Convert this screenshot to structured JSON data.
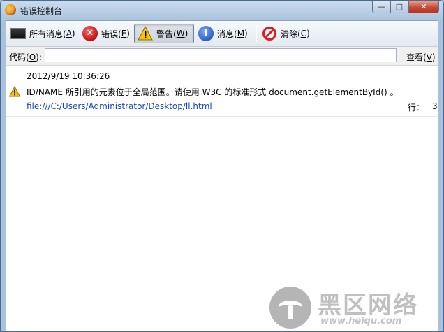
{
  "window": {
    "title": "错误控制台"
  },
  "titlebar": {
    "min_glyph": "—",
    "max_glyph": "□",
    "close_glyph": "✕"
  },
  "toolbar": {
    "all": {
      "label": "所有消息(",
      "key": "A",
      "suffix": ")"
    },
    "errors": {
      "label": "错误(",
      "key": "E",
      "suffix": ")"
    },
    "warnings": {
      "label": "警告(",
      "key": "W",
      "suffix": ")",
      "active": true
    },
    "messages": {
      "label": "消息(",
      "key": "M",
      "suffix": ")"
    },
    "clear": {
      "label": "清除(",
      "key": "C",
      "suffix": ")"
    }
  },
  "codebar": {
    "label": "代码(",
    "key": "O",
    "suffix": "):",
    "value": "",
    "view_label": "查看(",
    "view_key": "V",
    "view_suffix": ")"
  },
  "entries": [
    {
      "type": "warning",
      "timestamp": "2012/9/19 10:36:26",
      "message": "ID/NAME 所引用的元素位于全局范围。请使用 W3C 的标准形式 document.getElementById() 。",
      "source": "file:///C:/Users/Administrator/Desktop/ll.html",
      "line_label": "行：",
      "line": "3"
    }
  ],
  "watermark": {
    "text": "黑区网络",
    "url": "www.heiqu.com"
  },
  "colors": {
    "link": "#1a44c8",
    "close_button": "#c74a36",
    "error_icon": "#c41111",
    "info_icon": "#2a5fc9",
    "warning_icon": "#f4c20d"
  }
}
